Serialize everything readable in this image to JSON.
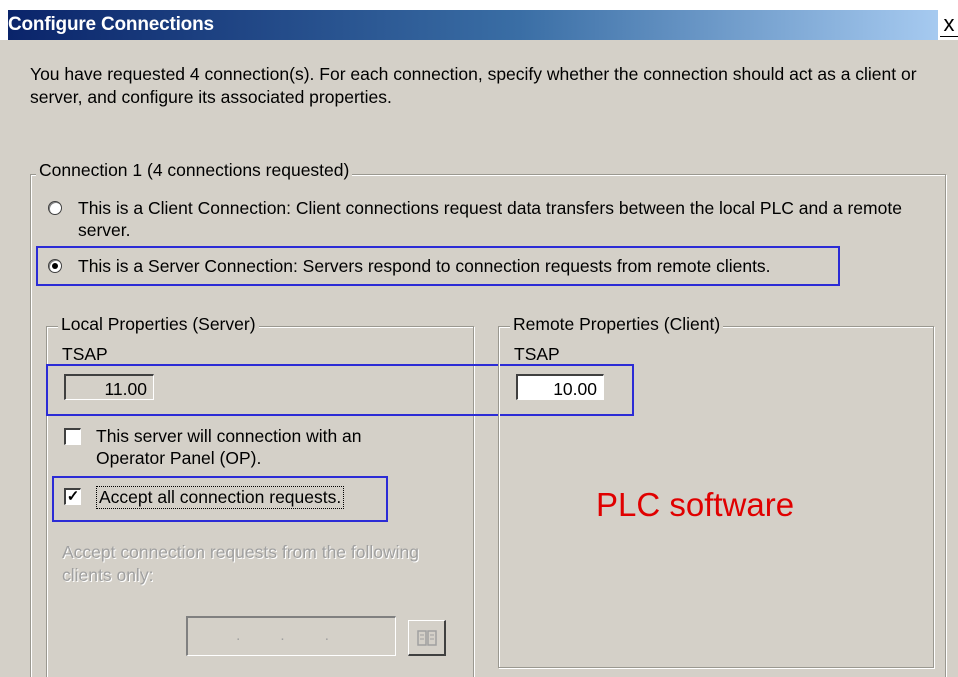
{
  "window": {
    "title": "Configure Connections",
    "close_glyph": "x"
  },
  "intro": {
    "text": "You have requested 4 connection(s).  For each connection, specify whether the connection should act as a client or server, and configure its associated properties."
  },
  "connection": {
    "legend": "Connection 1 (4 connections requested)",
    "client_option": {
      "label": "This is a Client Connection: Client connections request data transfers between the local PLC and a remote server.",
      "selected": false
    },
    "server_option": {
      "label": "This is a Server Connection: Servers respond to connection requests from remote clients.",
      "selected": true
    }
  },
  "local": {
    "legend": "Local Properties (Server)",
    "tsap_label": "TSAP",
    "tsap_value": "11.00",
    "op_checkbox": {
      "label_line1": "This server will connection with an",
      "label_line2": "Operator Panel (OP).",
      "checked": false
    },
    "accept_all_checkbox": {
      "label": "Accept all connection requests.",
      "checked": true
    },
    "accept_from_label_line1": "Accept connection requests from the following",
    "accept_from_label_line2": "clients only:",
    "clients_input_placeholder": ". . ."
  },
  "remote": {
    "legend": "Remote Properties (Client)",
    "tsap_label": "TSAP",
    "tsap_value": "10.00"
  },
  "overlay": {
    "annotation": "PLC software",
    "annotation_color": "#e00000",
    "highlight_color": "#2b2bd6"
  },
  "icons": {
    "check": "✓",
    "clients_button_icon": "address-book-icon"
  }
}
